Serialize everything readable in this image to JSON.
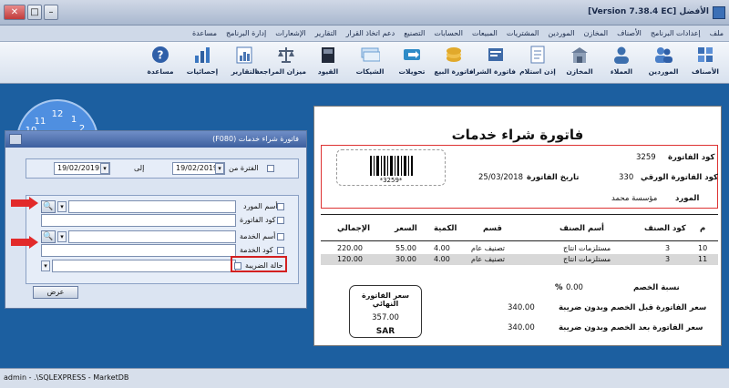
{
  "window": {
    "title": "الأفضل  [Version 7.38.4 EC]",
    "close_glyph": "✕",
    "max_glyph": "□",
    "min_glyph": "–"
  },
  "menu": [
    "ملف",
    "إعدادات البرنامج",
    "الأصناف",
    "المخازن",
    "الموردين",
    "المشتريات",
    "المبيعات",
    "الحسابات",
    "التصنيع",
    "دعم اتخاذ القرار",
    "التقارير",
    "الإشعارات",
    "إدارة البرنامج",
    "مساعدة"
  ],
  "toolbar": [
    {
      "label": "الأصناف",
      "icon": "items-icon",
      "color": "#3b6fb6"
    },
    {
      "label": "الموردين",
      "icon": "suppliers-icon",
      "color": "#4a7fc8"
    },
    {
      "label": "العملاء",
      "icon": "customers-icon",
      "color": "#3c6fae"
    },
    {
      "label": "المخازن",
      "icon": "warehouse-icon",
      "color": "#6a7d99"
    },
    {
      "label": "إذن استلام",
      "icon": "receipt-icon",
      "color": "#5c7fb5"
    },
    {
      "label": "فاتورة الشراء",
      "icon": "purchase-invoice-icon",
      "color": "#3e6aa7"
    },
    {
      "label": "فاتورة البيع",
      "icon": "sales-invoice-icon",
      "color": "#e1a92b"
    },
    {
      "label": "تحويلات",
      "icon": "transfers-icon",
      "color": "#2e8bc7"
    },
    {
      "label": "الشيكات",
      "icon": "checks-icon",
      "color": "#6b9fd2"
    },
    {
      "label": "القيود",
      "icon": "journal-icon",
      "color": "#222a3a"
    },
    {
      "label": "ميزان المراجعة",
      "icon": "trial-balance-icon",
      "color": "#4f5f78"
    },
    {
      "label": "التقارير",
      "icon": "reports-icon",
      "color": "#4c77b4"
    },
    {
      "label": "إحصائيات",
      "icon": "statistics-icon",
      "color": "#3a76c0"
    },
    {
      "label": "مساعدة",
      "icon": "help-icon",
      "color": "#2f5fa8"
    }
  ],
  "clock": {
    "n12": "12",
    "n11": "11",
    "n10": "10",
    "n1": "1",
    "n2": "2"
  },
  "dialog": {
    "title": "فاتورة شراء خدمات  (F080)",
    "period_label": "الفترة من",
    "date_from": "19/02/2019",
    "to_label": "إلى",
    "date_to": "19/02/2019",
    "supplier_name_label": "أسم المورد",
    "invoice_code_label": "كود الفاتورة",
    "service_name_label": "أسم الخدمة",
    "service_code_label": "كود الخدمة",
    "tax_status_label": "حالة الضريبة",
    "show_button": "عرض",
    "dropdown_glyph": "▾",
    "search_glyph": "🔍"
  },
  "invoice": {
    "title": "فاتورة  شراء خدمات",
    "code_label": "كود الفاتورة",
    "code_value": "3259",
    "paper_code_label": "كود الفاتورة الورقي",
    "paper_code_value": "330",
    "date_label": "تاريخ الفاتورة",
    "date_value": "25/03/2018",
    "supplier_label": "المورد",
    "supplier_value": "مؤسسة محمد",
    "barcode_text": "*3259*",
    "columns": {
      "no": "م",
      "item_code": "كود الصنف",
      "item_name": "أسم الصنف",
      "section": "قسم",
      "qty": "الكمية",
      "price": "السعر",
      "total": "الإجمالي"
    },
    "rows": [
      {
        "no": "10",
        "item_code": "3",
        "item_name": "مستلزمات انتاج",
        "section": "تصنيف عام",
        "qty": "4.00",
        "price": "55.00",
        "total": "220.00"
      },
      {
        "no": "11",
        "item_code": "3",
        "item_name": "مستلزمات انتاج",
        "section": "تصنيف عام",
        "qty": "4.00",
        "price": "30.00",
        "total": "120.00"
      }
    ],
    "discount_label": "نسبة الخصم",
    "discount_value": "0.00",
    "percent_sign": "%",
    "before_discount_label": "سعر الفاتورة قبل الخصم وبدون ضريبة",
    "before_discount_value": "340.00",
    "after_discount_label": "سعر الفاتورة بعد الخصم وبدون ضريبة",
    "after_discount_value": "340.00",
    "final_label": "سعر الفاتورة النهائي",
    "final_value": "357.00",
    "currency": "SAR"
  },
  "status": {
    "text": "admin  -  .\\SQLEXPRESS  -  MarketDB"
  }
}
